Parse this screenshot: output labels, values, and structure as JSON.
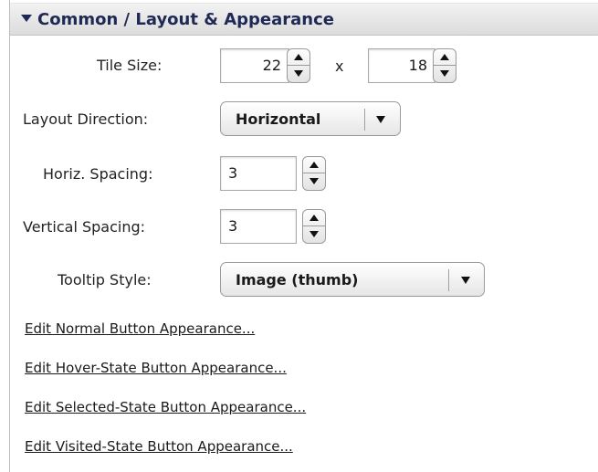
{
  "section": {
    "title": "Common / Layout & Appearance"
  },
  "tile_size": {
    "label": "Tile Size:",
    "width": "22",
    "separator": "x",
    "height": "18"
  },
  "layout_direction": {
    "label": "Layout Direction:",
    "value": "Horizontal"
  },
  "horiz_spacing": {
    "label": "Horiz. Spacing:",
    "value": "3"
  },
  "vertical_spacing": {
    "label": "Vertical Spacing:",
    "value": "3"
  },
  "tooltip_style": {
    "label": "Tooltip Style:",
    "value": "Image (thumb)"
  },
  "links": [
    "Edit Normal Button Appearance...",
    "Edit Hover-State Button Appearance...",
    "Edit Selected-State Button Appearance...",
    "Edit Visited-State Button Appearance..."
  ],
  "colors": {
    "header_text": "#1e2a55",
    "header_bg": "#e6e6e6"
  }
}
